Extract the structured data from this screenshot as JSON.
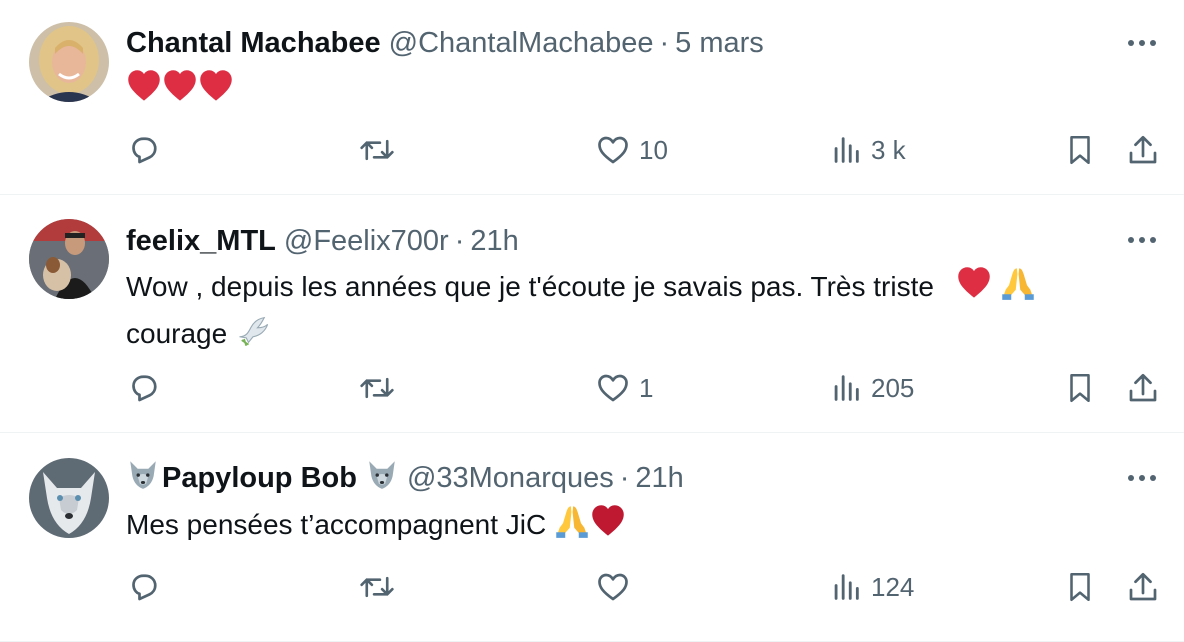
{
  "colors": {
    "text": "#0f1419",
    "secondary": "#536471",
    "divider": "#eff3f4",
    "heart": "#e0245e"
  },
  "tweets": [
    {
      "name": "Chantal Machabee",
      "name_prefix_emoji": "",
      "name_suffix_emoji": "",
      "handle": "@ChantalMachabee",
      "separator": "·",
      "time": "5 mars",
      "text_line1": "",
      "text_line2": "",
      "trailing_emojis": [
        "red-heart",
        "red-heart",
        "red-heart"
      ],
      "stats": {
        "replies": "",
        "reposts": "",
        "likes": "10",
        "views": "3 k"
      }
    },
    {
      "name": "feelix_MTL",
      "name_prefix_emoji": "",
      "name_suffix_emoji": "",
      "handle": "@Feelix700r",
      "separator": "·",
      "time": "21h",
      "text_line1": "Wow , depuis les années que je t'écoute je savais pas. Très triste",
      "text_line2": "courage",
      "trailing_emojis": [
        "red-heart",
        "folded-hands",
        "dove"
      ],
      "stats": {
        "replies": "",
        "reposts": "",
        "likes": "1",
        "views": "205"
      }
    },
    {
      "name": "Papyloup Bob",
      "name_prefix_emoji": "wolf-face",
      "name_suffix_emoji": "wolf-face",
      "handle": "@33Monarques",
      "separator": "·",
      "time": "21h",
      "text_line1": "Mes pensées t’accompagnent JiC",
      "text_line2": "",
      "trailing_emojis": [
        "folded-hands",
        "red-heart"
      ],
      "stats": {
        "replies": "",
        "reposts": "",
        "likes": "",
        "views": "124"
      }
    }
  ]
}
